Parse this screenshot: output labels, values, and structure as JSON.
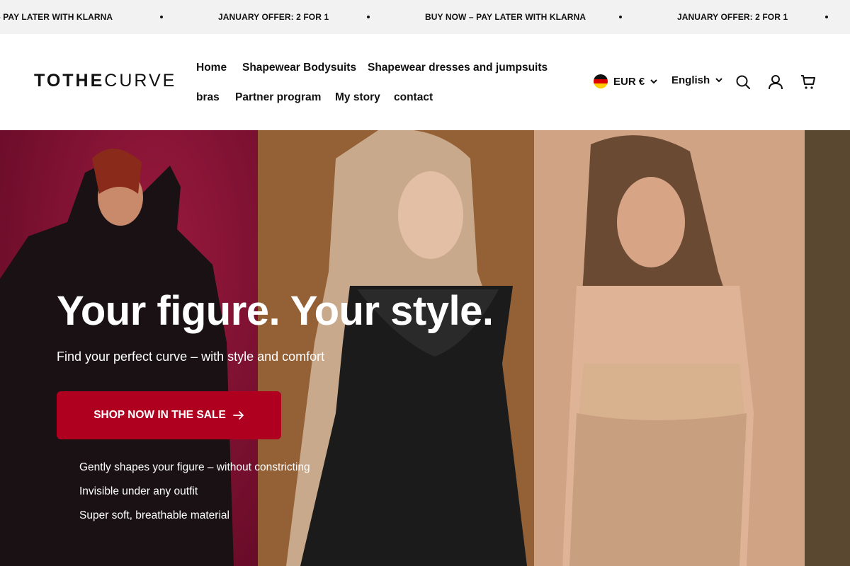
{
  "announcement": {
    "messages": [
      "BUY NOW – PAY LATER WITH KLARNA",
      "JANUARY OFFER: 2 FOR 1",
      "BUY NOW – PAY LATER WITH KLARNA",
      "JANUARY OFFER: 2 FOR 1"
    ],
    "partial_message": "– PAY LATER WITH KLARNA"
  },
  "header": {
    "logo_bold": "TOTHE",
    "logo_light": "CURVE",
    "nav": [
      "Home",
      "Shapewear Bodysuits",
      "Shapewear dresses and jumpsuits",
      "bras",
      "Partner program",
      "My story",
      "contact"
    ],
    "currency": "EUR €",
    "language": "English",
    "icons": {
      "flag": "germany-flag-icon",
      "search": "search-icon",
      "account": "account-icon",
      "cart": "cart-icon"
    }
  },
  "hero": {
    "title": "Your figure. Your style.",
    "subtitle": "Find your perfect curve – with style and comfort",
    "cta_label": "SHOP NOW IN THE SALE",
    "benefits": [
      "Gently shapes your figure – without constricting",
      "Invisible under any outfit",
      "Super soft, breathable material"
    ]
  },
  "colors": {
    "announcement_bg": "#f2f2f2",
    "cta_bg": "#b00020",
    "panel_1": "#7a1030",
    "panel_2": "#946036",
    "panel_3": "#d0a384",
    "panel_4": "#5a4831"
  }
}
